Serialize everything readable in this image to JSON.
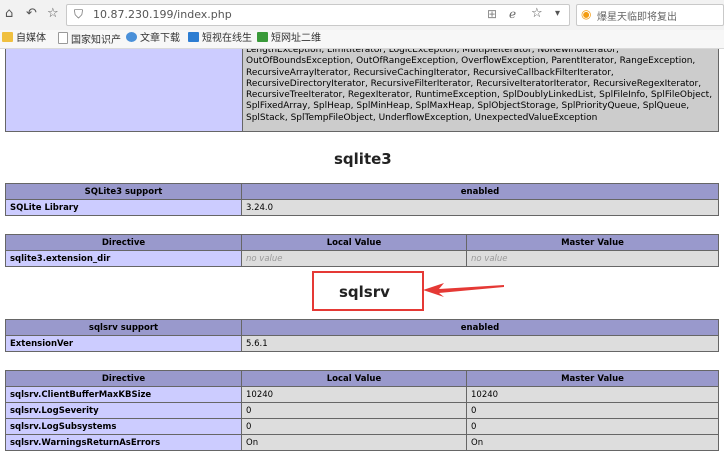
{
  "browser": {
    "url": "10.87.230.199/index.php",
    "search_text": "爆星天临即将复出",
    "bookmarks": [
      "自媒体",
      "国家知识产",
      "文章下载",
      "短视在线生",
      "短网址二维"
    ]
  },
  "classes_text": "LengthException, LimitIterator, LogicException, MultipleIterator, NoRewindIterator, OutOfBoundsException, OutOfRangeException, OverflowException, ParentIterator, RangeException, RecursiveArrayIterator, RecursiveCachingIterator, RecursiveCallbackFilterIterator, RecursiveDirectoryIterator, RecursiveFilterIterator, RecursiveIteratorIterator, RecursiveRegexIterator, RecursiveTreeIterator, RegexIterator, RuntimeException, SplDoublyLinkedList, SplFileInfo, SplFileObject, SplFixedArray, SplHeap, SplMinHeap, SplMaxHeap, SplObjectStorage, SplPriorityQueue, SplQueue, SplStack, SplTempFileObject, UnderflowException, UnexpectedValueException",
  "sqlite3": {
    "title": "sqlite3",
    "support": {
      "header": "SQLite3 support",
      "value": "enabled"
    },
    "library": {
      "label": "SQLite Library",
      "value": "3.24.0"
    },
    "directives": {
      "headers": [
        "Directive",
        "Local Value",
        "Master Value"
      ],
      "row": {
        "name": "sqlite3.extension_dir",
        "local": "no value",
        "master": "no value"
      }
    }
  },
  "sqlsrv": {
    "title": "sqlsrv",
    "support": {
      "header": "sqlsrv support",
      "value": "enabled"
    },
    "version": {
      "label": "ExtensionVer",
      "value": "5.6.1"
    },
    "directives": {
      "headers": [
        "Directive",
        "Local Value",
        "Master Value"
      ],
      "rows": [
        {
          "name": "sqlsrv.ClientBufferMaxKBSize",
          "local": "10240",
          "master": "10240"
        },
        {
          "name": "sqlsrv.LogSeverity",
          "local": "0",
          "master": "0"
        },
        {
          "name": "sqlsrv.LogSubsystems",
          "local": "0",
          "master": "0"
        },
        {
          "name": "sqlsrv.WarningsReturnAsErrors",
          "local": "On",
          "master": "On"
        }
      ]
    }
  },
  "colors": {
    "header_bg": "#9999cc",
    "label_bg": "#ccccff",
    "value_bg": "#dddddd",
    "annotation_red": "#e53935"
  },
  "icons": [
    "home-icon",
    "back-icon",
    "star-icon",
    "shield-icon",
    "grid-icon",
    "favorite-icon",
    "dropdown-icon",
    "search-icon",
    "arrow-annotation"
  ]
}
